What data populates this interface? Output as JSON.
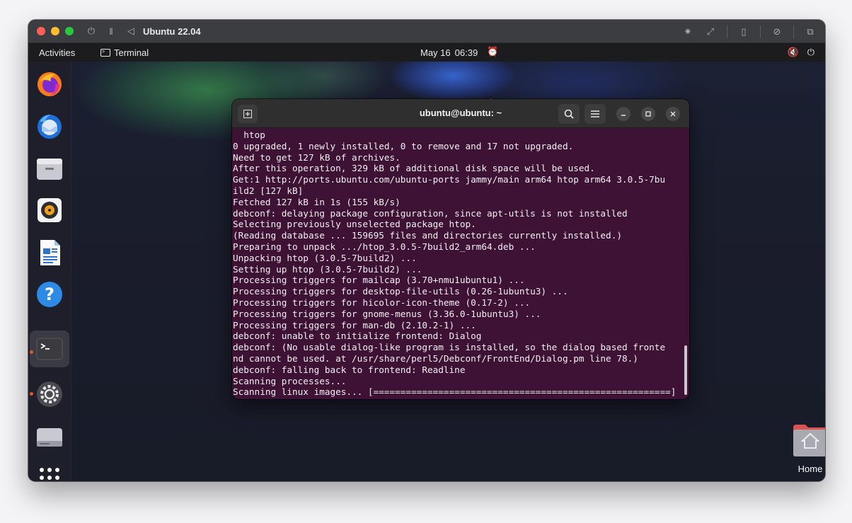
{
  "vm": {
    "title": "Ubuntu 22.04",
    "controls": [
      "power-icon",
      "pause-icon",
      "back-icon"
    ],
    "toolbar_icons": [
      "brightness-icon",
      "resize-icon",
      "usb-icon",
      "sharing-icon",
      "windows-icon"
    ]
  },
  "topbar": {
    "activities": "Activities",
    "app_name": "Terminal",
    "date": "May 16",
    "time": "06:39",
    "status_icons": [
      "volume-muted-icon",
      "power-icon"
    ]
  },
  "dock": {
    "apps": [
      {
        "name": "Firefox",
        "icon": "firefox-icon",
        "running": false
      },
      {
        "name": "Thunderbird",
        "icon": "thunderbird-icon",
        "running": false
      },
      {
        "name": "Files",
        "icon": "files-icon",
        "running": false
      },
      {
        "name": "Rhythmbox",
        "icon": "rhythmbox-icon",
        "running": false
      },
      {
        "name": "LibreOffice Writer",
        "icon": "writer-icon",
        "running": false
      },
      {
        "name": "Help",
        "icon": "help-icon",
        "running": false
      },
      {
        "name": "Terminal",
        "icon": "terminal-icon",
        "running": true
      },
      {
        "name": "Settings",
        "icon": "settings-icon",
        "running": true
      },
      {
        "name": "Disk",
        "icon": "disk-icon",
        "running": false
      },
      {
        "name": "Show Applications",
        "icon": "app-grid-icon",
        "running": false
      }
    ]
  },
  "terminal": {
    "title": "ubuntu@ubuntu: ~",
    "lines": [
      "  htop",
      "0 upgraded, 1 newly installed, 0 to remove and 17 not upgraded.",
      "Need to get 127 kB of archives.",
      "After this operation, 329 kB of additional disk space will be used.",
      "Get:1 http://ports.ubuntu.com/ubuntu-ports jammy/main arm64 htop arm64 3.0.5-7bu",
      "ild2 [127 kB]",
      "Fetched 127 kB in 1s (155 kB/s)",
      "debconf: delaying package configuration, since apt-utils is not installed",
      "Selecting previously unselected package htop.",
      "(Reading database ... 159695 files and directories currently installed.)",
      "Preparing to unpack .../htop_3.0.5-7build2_arm64.deb ...",
      "Unpacking htop (3.0.5-7build2) ...",
      "Setting up htop (3.0.5-7build2) ...",
      "Processing triggers for mailcap (3.70+nmu1ubuntu1) ...",
      "Processing triggers for desktop-file-utils (0.26-1ubuntu3) ...",
      "Processing triggers for hicolor-icon-theme (0.17-2) ...",
      "Processing triggers for gnome-menus (3.36.0-1ubuntu3) ...",
      "Processing triggers for man-db (2.10.2-1) ...",
      "debconf: unable to initialize frontend: Dialog",
      "debconf: (No usable dialog-like program is installed, so the dialog based fronte",
      "nd cannot be used. at /usr/share/perl5/Debconf/FrontEnd/Dialog.pm line 78.)",
      "debconf: falling back to frontend: Readline",
      "Scanning processes...",
      "Scanning linux images... [=======================================================]"
    ]
  },
  "desktop": {
    "home_label": "Home"
  },
  "colors": {
    "terminal_bg": "#3d1235",
    "ubuntu_orange": "#e95420",
    "vm_titlebar": "#3b3d40"
  }
}
